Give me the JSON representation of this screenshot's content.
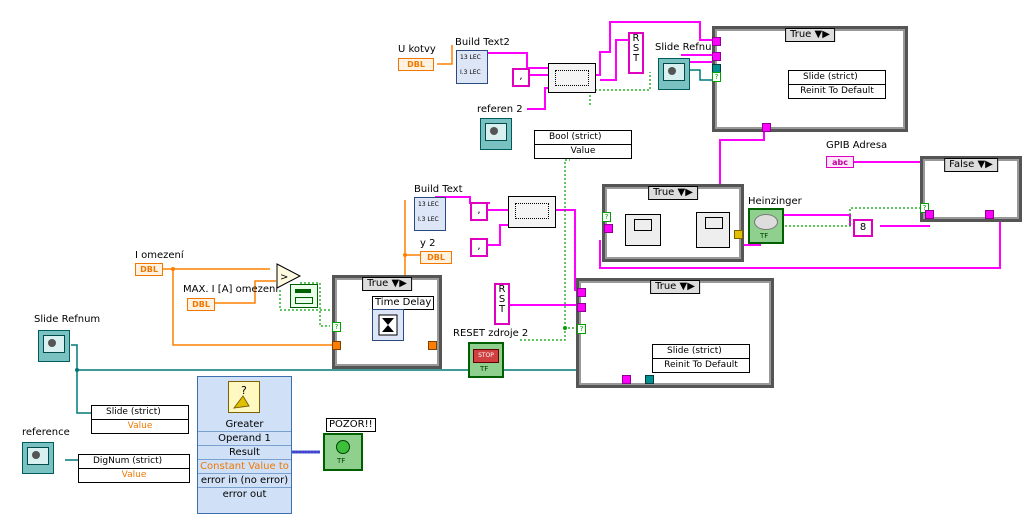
{
  "labels": {
    "u_kotvy": "U kotvy",
    "build_text2": "Build Text2",
    "build_text": "Build Text",
    "slide_refnum_top": "Slide Refnum",
    "referen": "referen 2",
    "gpib_adresa": "GPIB Adresa",
    "heinzinger": "Heinzinger",
    "y2": "y 2",
    "i_omezeni": "I omezení",
    "max_i": "MAX. I [A] omezení",
    "time_delay": "Time Delay",
    "reset_zdroje": "RESET zdroje 2",
    "slide_refnum": "Slide Refnum",
    "reference": "reference",
    "pozor": "POZOR!!"
  },
  "terminals": {
    "dbl": "DBL",
    "abc": "abc",
    "tf": "TF",
    "stop": "STOP"
  },
  "constants": {
    "comma1": ",",
    "comma2": ",",
    "comma3": ",",
    "rst1": "R S T",
    "rst2": "R S T",
    "eight": "8"
  },
  "cases": {
    "true1": "True",
    "true2": "True",
    "true3": "True",
    "true4": "True",
    "false1": "False"
  },
  "nodes": {
    "bool": {
      "header": "Bool (strict)",
      "row": "Value"
    },
    "slide_top": {
      "header": "Slide (strict)",
      "row": "Reinit To Default"
    },
    "slide_mid": {
      "header": "Slide (strict)",
      "row": "Reinit To Default"
    },
    "slide_bot": {
      "header": "Slide (strict)",
      "row": "Value"
    },
    "dignum": {
      "header": "DigNum (strict)",
      "row": "Value"
    }
  },
  "greater": {
    "title": "Greater",
    "rows": [
      "Operand 1",
      "Result",
      "Constant Value to",
      "error in (no error)",
      "error out"
    ]
  },
  "build_text_icon": {
    "line1": "13  LEC",
    "line2": "I.3 LEC"
  }
}
